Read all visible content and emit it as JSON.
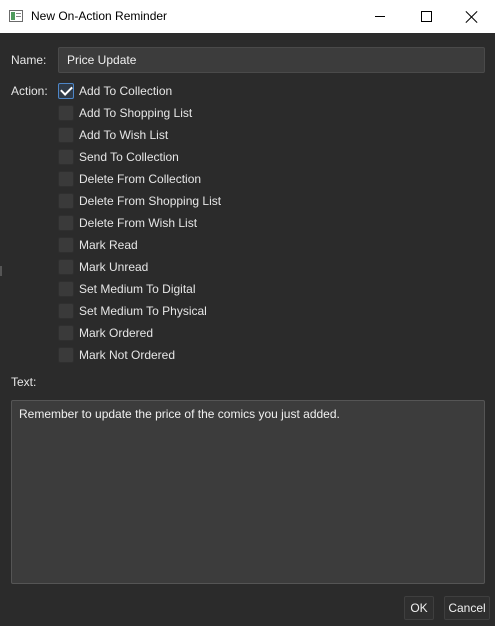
{
  "window": {
    "title": "New On-Action Reminder",
    "icon": "app-window-icon",
    "controls": {
      "minimize": "minimize-icon",
      "maximize": "maximize-icon",
      "close": "close-icon"
    }
  },
  "form": {
    "name_label": "Name:",
    "name_value": "Price Update",
    "action_label": "Action:",
    "actions": [
      {
        "label": "Add To Collection",
        "checked": true
      },
      {
        "label": "Add To Shopping List",
        "checked": false
      },
      {
        "label": "Add To Wish List",
        "checked": false
      },
      {
        "label": "Send To Collection",
        "checked": false
      },
      {
        "label": "Delete From Collection",
        "checked": false
      },
      {
        "label": "Delete From Shopping List",
        "checked": false
      },
      {
        "label": "Delete From Wish List",
        "checked": false
      },
      {
        "label": "Mark Read",
        "checked": false
      },
      {
        "label": "Mark Unread",
        "checked": false
      },
      {
        "label": "Set Medium To Digital",
        "checked": false
      },
      {
        "label": "Set Medium To Physical",
        "checked": false
      },
      {
        "label": "Mark Ordered",
        "checked": false
      },
      {
        "label": "Mark Not Ordered",
        "checked": false
      }
    ],
    "text_label": "Text:",
    "text_value": "Remember to update the price of the comics you just added."
  },
  "buttons": {
    "ok": "OK",
    "cancel": "Cancel"
  },
  "colors": {
    "background": "#2b2b2b",
    "field": "#3c3c3c",
    "accent": "#4d86c8",
    "titlebar": "#ffffff"
  }
}
